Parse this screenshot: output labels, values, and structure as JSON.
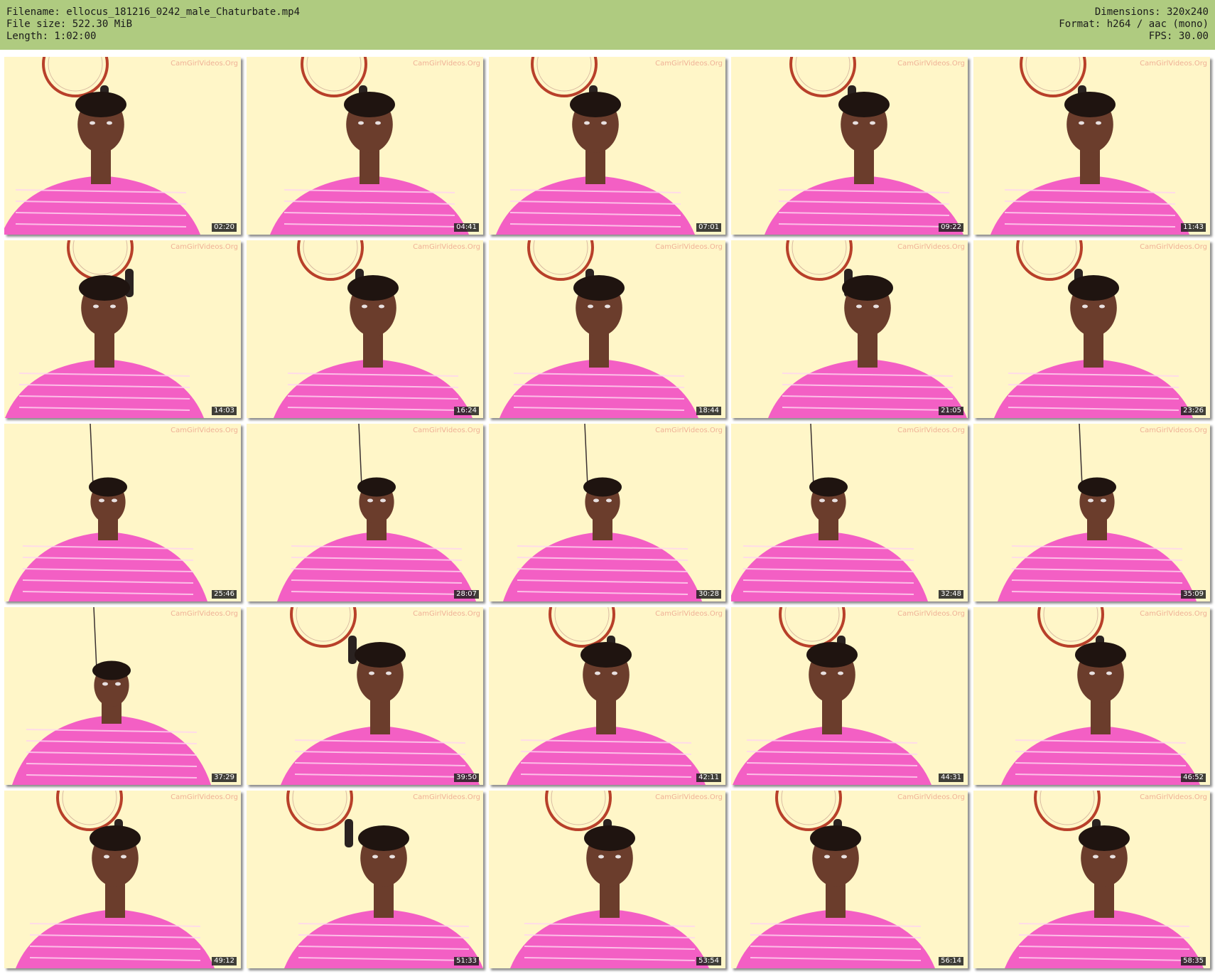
{
  "header": {
    "filename_line": "Filename: ellocus_181216_0242_male_Chaturbate.mp4",
    "filesize_line": "File size: 522.30 MiB",
    "length_line": "Length: 1:02:00",
    "dimensions_line": "Dimensions: 320x240",
    "format_line": "Format: h264 / aac (mono)",
    "fps_line": "FPS: 30.00"
  },
  "colors": {
    "header_bg": "#afcb80",
    "wall": "#fff6c8",
    "shirt": "#f35fc4",
    "skin": "#6b3d2c",
    "hair": "#1f1410",
    "fan_ring": "#b8402a"
  },
  "watermark": "CamGirlVideos.Org",
  "thumbnails": [
    {
      "time": "02:20",
      "scene": "fan"
    },
    {
      "time": "04:41",
      "scene": "fan"
    },
    {
      "time": "07:01",
      "scene": "fan"
    },
    {
      "time": "09:22",
      "scene": "fan"
    },
    {
      "time": "11:43",
      "scene": "fan"
    },
    {
      "time": "14:03",
      "scene": "fan"
    },
    {
      "time": "16:24",
      "scene": "fan"
    },
    {
      "time": "18:44",
      "scene": "fan"
    },
    {
      "time": "21:05",
      "scene": "fan"
    },
    {
      "time": "23:26",
      "scene": "fan"
    },
    {
      "time": "25:46",
      "scene": "wide"
    },
    {
      "time": "28:07",
      "scene": "wide"
    },
    {
      "time": "30:28",
      "scene": "wide"
    },
    {
      "time": "32:48",
      "scene": "wide"
    },
    {
      "time": "35:09",
      "scene": "wide"
    },
    {
      "time": "37:29",
      "scene": "wide"
    },
    {
      "time": "39:50",
      "scene": "fan"
    },
    {
      "time": "42:11",
      "scene": "fan"
    },
    {
      "time": "44:31",
      "scene": "fan"
    },
    {
      "time": "46:52",
      "scene": "fan"
    },
    {
      "time": "49:12",
      "scene": "fan"
    },
    {
      "time": "51:33",
      "scene": "fan"
    },
    {
      "time": "53:54",
      "scene": "fan"
    },
    {
      "time": "56:14",
      "scene": "fan"
    },
    {
      "time": "58:35",
      "scene": "fan"
    }
  ]
}
